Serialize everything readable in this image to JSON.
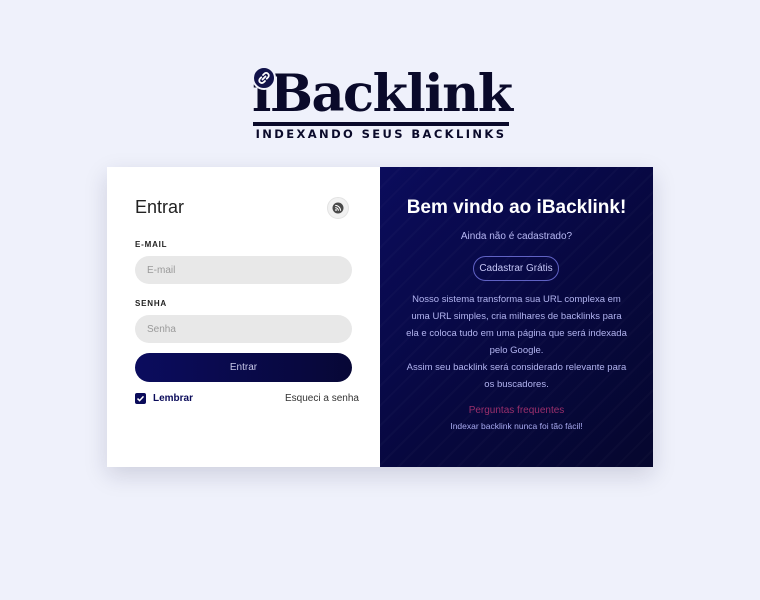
{
  "brand": {
    "name": "iBacklink",
    "tagline": "INDEXANDO SEUS BACKLINKS"
  },
  "login": {
    "title": "Entrar",
    "email_label": "E-MAIL",
    "email_placeholder": "E-mail",
    "email_value": "",
    "password_label": "SENHA",
    "password_placeholder": "Senha",
    "password_value": "",
    "submit_label": "Entrar",
    "remember_label": "Lembrar",
    "remember_checked": true,
    "forgot_label": "Esqueci a senha"
  },
  "welcome": {
    "title": "Bem vindo ao iBacklink!",
    "subtitle": "Ainda não é cadastrado?",
    "register_label": "Cadastrar Grátis",
    "description_1": "Nosso sistema transforma sua URL complexa em uma URL simples, cria milhares de backlinks para ela e coloca tudo em uma página que será indexada pelo Google.",
    "description_2": "Assim seu backlink será considerado relevante para os buscadores.",
    "faq_label": "Perguntas frequentes",
    "slogan": "Indexar backlink nunca foi tão fácil!"
  },
  "colors": {
    "background": "#eff1fb",
    "navy": "#0a0b5a",
    "panel_dark": "#07083f",
    "faq_link": "#9a2f6b"
  },
  "icons": {
    "logo_badge": "link-icon",
    "title_badge": "rss-icon",
    "checkbox": "check-icon"
  }
}
